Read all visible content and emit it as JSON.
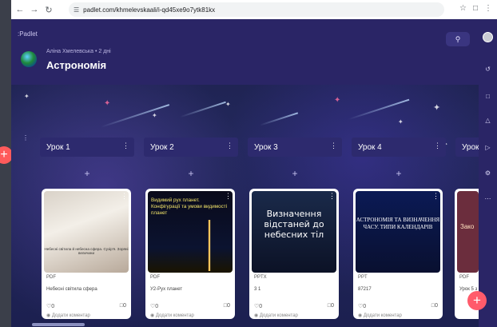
{
  "browser": {
    "url": "padlet.com/khmelevskaali/i-qd45xe9o7ytk81kx",
    "back_icon": "arrow-left-icon",
    "forward_icon": "arrow-right-icon",
    "reload_icon": "reload-icon"
  },
  "header": {
    "logo": ":Padlet",
    "author_line": "Аліна Хмелевська • 2 дні",
    "title": "Астрономія",
    "search_icon": "search-icon"
  },
  "sections": [
    {
      "title": "Урок 1"
    },
    {
      "title": "Урок 2"
    },
    {
      "title": "Урок 3"
    },
    {
      "title": "Урок 4"
    },
    {
      "title": "Урок"
    }
  ],
  "cards": [
    {
      "type": "PDF",
      "caption": "Небесні світила сфера",
      "likes": "0",
      "comments": "0",
      "add_comment": "Додати коментар",
      "thumb_text": "Небесні світила й небесна сфера. Сузір'я. Зоряні величини"
    },
    {
      "type": "PDF",
      "caption": "У2-Рух планет",
      "likes": "0",
      "comments": "0",
      "add_comment": "Додати коментар",
      "thumb_text": "Видимий рух планет. Конфігурації та умови видимості планет"
    },
    {
      "type": "PPTX",
      "caption": "3 1",
      "likes": "0",
      "comments": "0",
      "add_comment": "Додати коментар",
      "thumb_text": "Визначення відстаней до небесних тіл"
    },
    {
      "type": "PPT",
      "caption": "87217",
      "likes": "0",
      "comments": "0",
      "add_comment": "Додати коментар",
      "thumb_text": "АСТРОНОМІЯ ТА ВИЗНАЧЕННЯ ЧАСУ. ТИПИ КАЛЕНДАРІВ"
    },
    {
      "type": "PDF",
      "caption": "Урок 5 з",
      "thumb_text": "Зако"
    }
  ],
  "colors": {
    "accent": "#ff5b6b",
    "header_bg": "#2a2566",
    "section_bg": "#2d2a6e"
  }
}
